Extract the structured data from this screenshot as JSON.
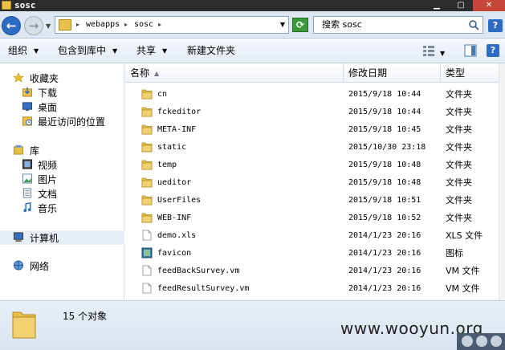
{
  "window": {
    "title": "sosc"
  },
  "address": {
    "crumbs": [
      "webapps",
      "sosc"
    ]
  },
  "search": {
    "text": "搜索 sosc"
  },
  "toolbar": {
    "organize": "组织",
    "include_library": "包含到库中",
    "share": "共享",
    "new_folder": "新建文件夹"
  },
  "nav": {
    "favorites": "收藏夹",
    "downloads": "下载",
    "desktop": "桌面",
    "recent": "最近访问的位置",
    "libraries": "库",
    "videos": "视频",
    "pictures": "图片",
    "documents": "文档",
    "music": "音乐",
    "computer": "计算机",
    "network": "网络"
  },
  "columns": {
    "name": "名称",
    "date": "修改日期",
    "type": "类型"
  },
  "files": [
    {
      "name": "cn",
      "date": "2015/9/18 10:44",
      "type": "文件夹",
      "icon": "folder-icon"
    },
    {
      "name": "fckeditor",
      "date": "2015/9/18 10:44",
      "type": "文件夹",
      "icon": "folder-icon"
    },
    {
      "name": "META-INF",
      "date": "2015/9/18 10:45",
      "type": "文件夹",
      "icon": "folder-icon"
    },
    {
      "name": "static",
      "date": "2015/10/30 23:18",
      "type": "文件夹",
      "icon": "folder-icon"
    },
    {
      "name": "temp",
      "date": "2015/9/18 10:48",
      "type": "文件夹",
      "icon": "folder-icon"
    },
    {
      "name": "ueditor",
      "date": "2015/9/18 10:48",
      "type": "文件夹",
      "icon": "folder-icon"
    },
    {
      "name": "UserFiles",
      "date": "2015/9/18 10:51",
      "type": "文件夹",
      "icon": "folder-icon"
    },
    {
      "name": "WEB-INF",
      "date": "2015/9/18 10:52",
      "type": "文件夹",
      "icon": "folder-icon"
    },
    {
      "name": "demo.xls",
      "date": "2014/1/23 20:16",
      "type": "XLS 文件",
      "icon": "file-icon"
    },
    {
      "name": "favicon",
      "date": "2014/1/23 20:16",
      "type": "图标",
      "icon": "image-icon"
    },
    {
      "name": "feedBackSurvey.vm",
      "date": "2014/1/23 20:16",
      "type": "VM 文件",
      "icon": "file-icon"
    },
    {
      "name": "feedResultSurvey.vm",
      "date": "2014/1/23 20:16",
      "type": "VM 文件",
      "icon": "file-icon"
    }
  ],
  "status": {
    "count": "15 个对象"
  },
  "watermark": "www.wooyun.org",
  "colors": {
    "folder": "#e8c04a",
    "accent": "#2e6bc4"
  }
}
